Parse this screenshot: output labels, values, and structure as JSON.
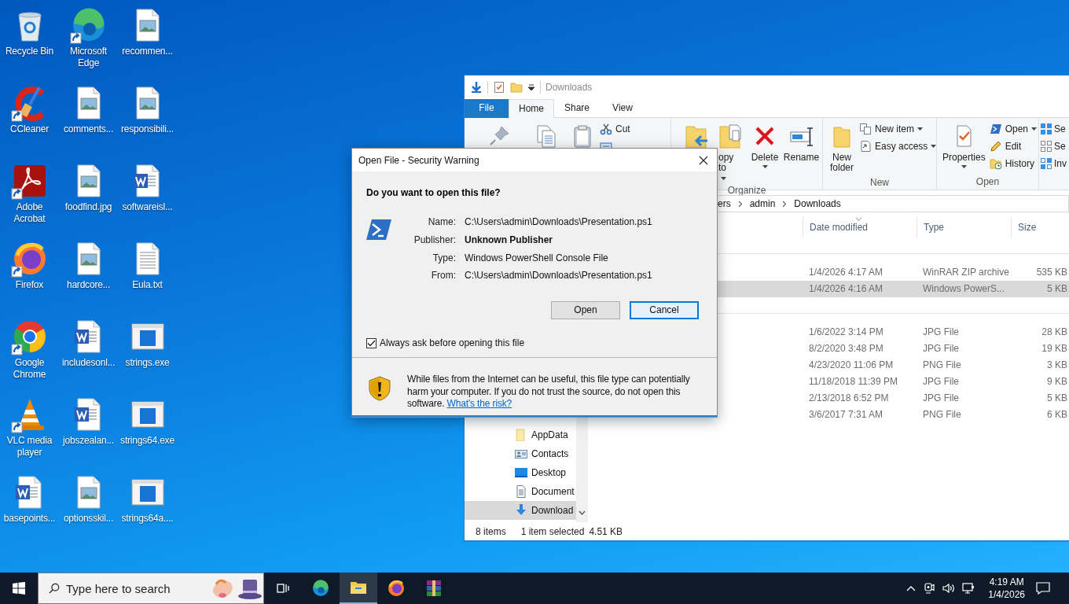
{
  "desktop_icons": [
    {
      "label": "Recycle Bin",
      "kind": "recycle",
      "shortcut": false
    },
    {
      "label": "Microsoft Edge",
      "kind": "edge",
      "shortcut": true
    },
    {
      "label": "recommen...",
      "kind": "image",
      "shortcut": false
    },
    {
      "label": "CCleaner",
      "kind": "ccleaner",
      "shortcut": true
    },
    {
      "label": "comments...",
      "kind": "image",
      "shortcut": false
    },
    {
      "label": "responsibili...",
      "kind": "image",
      "shortcut": false
    },
    {
      "label": "Adobe Acrobat",
      "kind": "acrobat",
      "shortcut": true
    },
    {
      "label": "foodfind.jpg",
      "kind": "image",
      "shortcut": false
    },
    {
      "label": "softwareisl...",
      "kind": "word",
      "shortcut": false
    },
    {
      "label": "Firefox",
      "kind": "firefox",
      "shortcut": true
    },
    {
      "label": "hardcore...",
      "kind": "image",
      "shortcut": false
    },
    {
      "label": "Eula.txt",
      "kind": "text",
      "shortcut": false
    },
    {
      "label": "Google Chrome",
      "kind": "chrome",
      "shortcut": true
    },
    {
      "label": "includesonl...",
      "kind": "word",
      "shortcut": false
    },
    {
      "label": "strings.exe",
      "kind": "exe",
      "shortcut": false
    },
    {
      "label": "VLC media player",
      "kind": "vlc",
      "shortcut": true
    },
    {
      "label": "jobszealan...",
      "kind": "word",
      "shortcut": false
    },
    {
      "label": "strings64.exe",
      "kind": "exe",
      "shortcut": false
    },
    {
      "label": "basepoints...",
      "kind": "word",
      "shortcut": false
    },
    {
      "label": "optionsskil...",
      "kind": "image",
      "shortcut": false
    },
    {
      "label": "strings64a....",
      "kind": "exe",
      "shortcut": false
    }
  ],
  "explorer": {
    "title": "Downloads",
    "tabs": [
      {
        "label": "File",
        "kind": "file",
        "selected": false
      },
      {
        "label": "Home",
        "kind": "tab",
        "selected": true
      },
      {
        "label": "Share",
        "kind": "tab",
        "selected": false
      },
      {
        "label": "View",
        "kind": "tab",
        "selected": false
      }
    ],
    "ribbon": [
      {
        "items": [
          {
            "kind": "pin"
          },
          {
            "kind": "copy"
          },
          {
            "kind": "paste"
          },
          {
            "kind": "cut",
            "label": "Cut"
          },
          {
            "kind": "copy-path"
          }
        ]
      },
      {
        "label": "Organize",
        "items": [
          {
            "kind": "move-to"
          },
          {
            "kind": "copy-to",
            "label": "opy to",
            "dropdown": true
          },
          {
            "kind": "delete",
            "label": "Delete",
            "dropdown": true
          },
          {
            "kind": "rename",
            "label": "Rename"
          }
        ]
      },
      {
        "label": "New",
        "items": [
          {
            "kind": "new-folder",
            "label": "New folder"
          },
          {
            "kind": "new-item",
            "label": "New item",
            "dropdown": true
          },
          {
            "kind": "easy-access",
            "label": "Easy access",
            "dropdown": true
          }
        ]
      },
      {
        "label": "Open",
        "items": [
          {
            "kind": "properties",
            "label": "Properties",
            "dropdown": true
          },
          {
            "kind": "open",
            "label": "Open",
            "dropdown": true
          },
          {
            "kind": "edit",
            "label": "Edit"
          },
          {
            "kind": "history",
            "label": "History"
          }
        ]
      },
      {
        "items": [
          {
            "kind": "select-all",
            "label": "Se"
          },
          {
            "kind": "select-none",
            "label": "Se"
          },
          {
            "kind": "invert",
            "label": "Inv"
          }
        ]
      }
    ],
    "breadcrumb": [
      "ers",
      "admin",
      "Downloads"
    ],
    "columns": [
      {
        "label": "Date modified",
        "sorted": true
      },
      {
        "label": "Type",
        "sorted": false
      },
      {
        "label": "Size",
        "sorted": false
      }
    ],
    "groups": [
      {
        "rows": [
          {
            "date": "1/4/2026 4:17 AM",
            "type": "WinRAR ZIP archive",
            "size": "535 KB",
            "selected": false
          },
          {
            "date": "1/4/2026 4:16 AM",
            "type": "Windows PowerS...",
            "size": "5 KB",
            "selected": true
          }
        ]
      },
      {
        "rows": [
          {
            "date": "1/6/2022 3:14 PM",
            "type": "JPG File",
            "size": "28 KB",
            "selected": false
          },
          {
            "date": "8/2/2020 3:48 PM",
            "type": "JPG File",
            "size": "19 KB",
            "selected": false
          },
          {
            "date": "4/23/2020 11:06 PM",
            "type": "PNG File",
            "size": "3 KB",
            "selected": false
          },
          {
            "date": "11/18/2018 11:39 PM",
            "type": "JPG File",
            "size": "9 KB",
            "selected": false
          },
          {
            "date": "2/13/2018 6:52 PM",
            "type": "JPG File",
            "size": "5 KB",
            "selected": false
          },
          {
            "date": "3/6/2017 7:31 AM",
            "type": "PNG File",
            "size": "6 KB",
            "selected": false
          }
        ]
      }
    ],
    "nav": [
      {
        "label": "AppData",
        "kind": "folder",
        "selected": false
      },
      {
        "label": "Contacts",
        "kind": "contacts",
        "selected": false
      },
      {
        "label": "Desktop",
        "kind": "desktop",
        "selected": false
      },
      {
        "label": "Document",
        "kind": "documents",
        "selected": false
      },
      {
        "label": "Download",
        "kind": "downloads",
        "selected": true
      }
    ],
    "status": {
      "count": "8 items",
      "selection": "1 item selected",
      "size": "4.51 KB"
    }
  },
  "dialog": {
    "title": "Open File - Security Warning",
    "question": "Do you want to open this file?",
    "fields": [
      {
        "label": "Name:",
        "value": "C:\\Users\\admin\\Downloads\\Presentation.ps1",
        "bold": false
      },
      {
        "label": "Publisher:",
        "value": "Unknown Publisher",
        "bold": true
      },
      {
        "label": "Type:",
        "value": "Windows PowerShell Console File",
        "bold": false
      },
      {
        "label": "From:",
        "value": "C:\\Users\\admin\\Downloads\\Presentation.ps1",
        "bold": false
      }
    ],
    "buttons": [
      {
        "label": "Open",
        "focused": false
      },
      {
        "label": "Cancel",
        "focused": true
      }
    ],
    "checkbox": {
      "label": "Always ask before opening this file",
      "checked": true
    },
    "warning": "While files from the Internet can be useful, this file type can potentially harm your computer. If you do not trust the source, do not open this software.",
    "link": "What's the risk?"
  },
  "taskbar": {
    "search_placeholder": "Type here to search",
    "apps": [
      {
        "kind": "task-view",
        "active": false
      },
      {
        "kind": "edge",
        "active": false
      },
      {
        "kind": "explorer",
        "active": true
      },
      {
        "kind": "firefox",
        "active": false
      },
      {
        "kind": "winrar",
        "active": false
      }
    ],
    "clock": {
      "time": "4:19 AM",
      "date": "1/4/2026"
    }
  }
}
